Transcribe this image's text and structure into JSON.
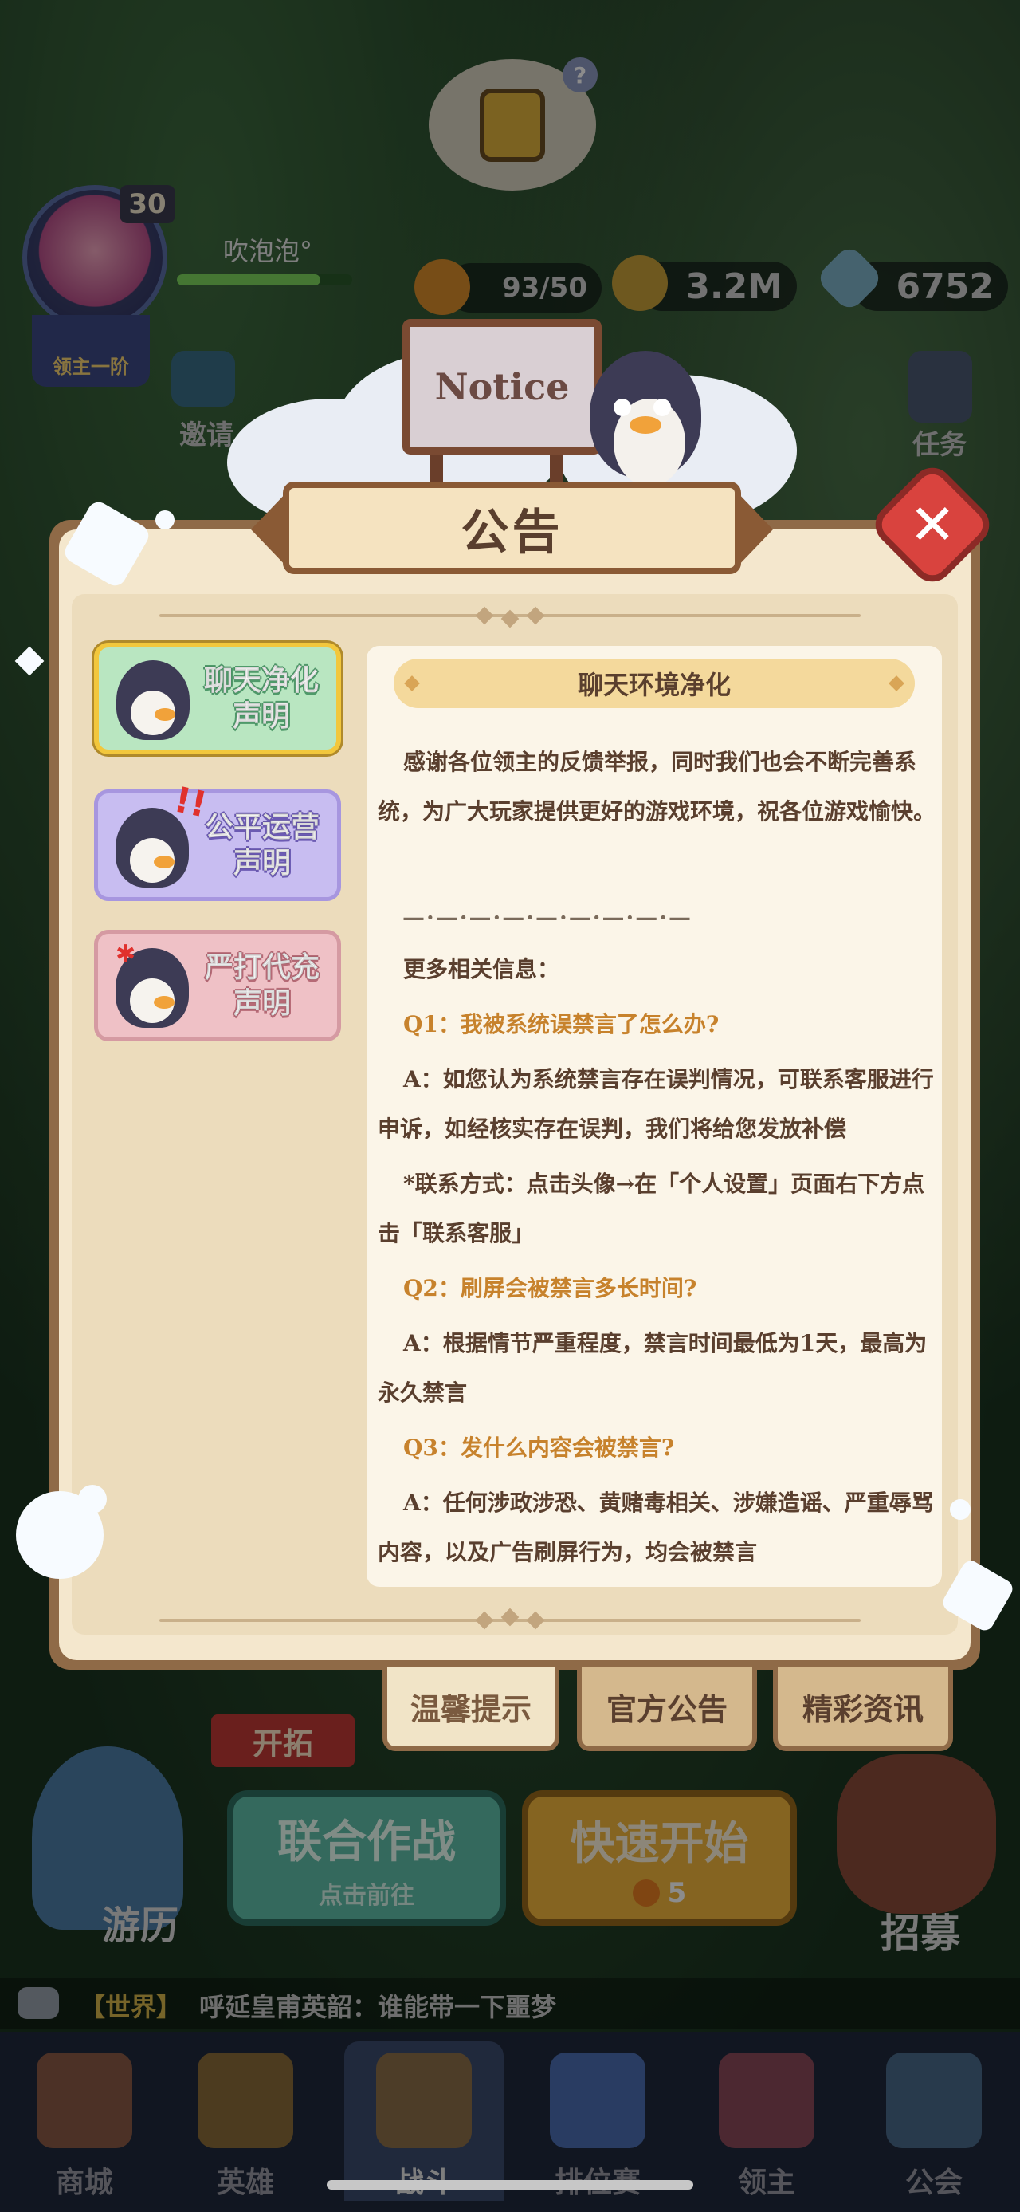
{
  "top_hud": {
    "player_level": "30",
    "player_name": "吹泡泡°",
    "lord_rank": "领主一阶",
    "energy": "93/50",
    "gold": "3.2M",
    "gems": "6752",
    "help_badge": "?",
    "xp_fraction": 0.82
  },
  "side_buttons": {
    "invite": "邀请",
    "task": "任务"
  },
  "board_sign": "Notice",
  "dialog": {
    "title": "公告",
    "close_symbol": "✕",
    "categories": [
      {
        "label_line1": "聊天净化",
        "label_line2": "声明",
        "selected": true
      },
      {
        "label_line1": "公平运营",
        "label_line2": "声明",
        "selected": false
      },
      {
        "label_line1": "严打代充",
        "label_line2": "声明",
        "selected": false
      }
    ],
    "content": {
      "header": "聊天环境净化",
      "intro": "感谢各位领主的反馈举报，同时我们也会不断完善系统，为广大玩家提供更好的游戏环境，祝各位游戏愉快。",
      "separator": "—·—·—·—·—·—·—·—·—",
      "more_info": "更多相关信息：",
      "q1": "Q1：我被系统误禁言了怎么办?",
      "a1": "A：如您认为系统禁言存在误判情况，可联系客服进行申诉，如经核实存在误判，我们将给您发放补偿",
      "contact": "*联系方式：点击头像→在「个人设置」页面右下方点击「联系客服」",
      "q2": "Q2：刷屏会被禁言多长时间?",
      "a2": "A：根据情节严重程度，禁言时间最低为1天，最高为永久禁言",
      "q3": "Q3：发什么内容会被禁言?",
      "a3": "A：任何涉政涉恐、黄赌毒相关、涉嫌造谣、严重辱骂内容，以及广告刷屏行为，均会被禁言"
    },
    "tabs": [
      {
        "label": "温馨提示",
        "active": true
      },
      {
        "label": "官方公告",
        "active": false
      },
      {
        "label": "精彩资讯",
        "active": false
      }
    ]
  },
  "lower_ui": {
    "explore_tag": "开拓",
    "travel": "游历",
    "coop_title": "联合作战",
    "coop_sub": "点击前往",
    "quick_title": "快速开始",
    "quick_cost": "5",
    "recruit": "招募"
  },
  "chat": {
    "channel": "【世界】",
    "message": "呼延皇甫英韶：谁能带一下噩梦"
  },
  "bottom_nav": [
    {
      "label": "商城"
    },
    {
      "label": "英雄"
    },
    {
      "label": "战斗"
    },
    {
      "label": "排位赛"
    },
    {
      "label": "领主"
    },
    {
      "label": "公会"
    }
  ],
  "colors": {
    "dialog_frame": "#8f6a47",
    "dialog_paper": "#f4e7cd",
    "question_orange": "#c7822c",
    "text_brown": "#5a3f2e",
    "close_red": "#d9433e"
  }
}
